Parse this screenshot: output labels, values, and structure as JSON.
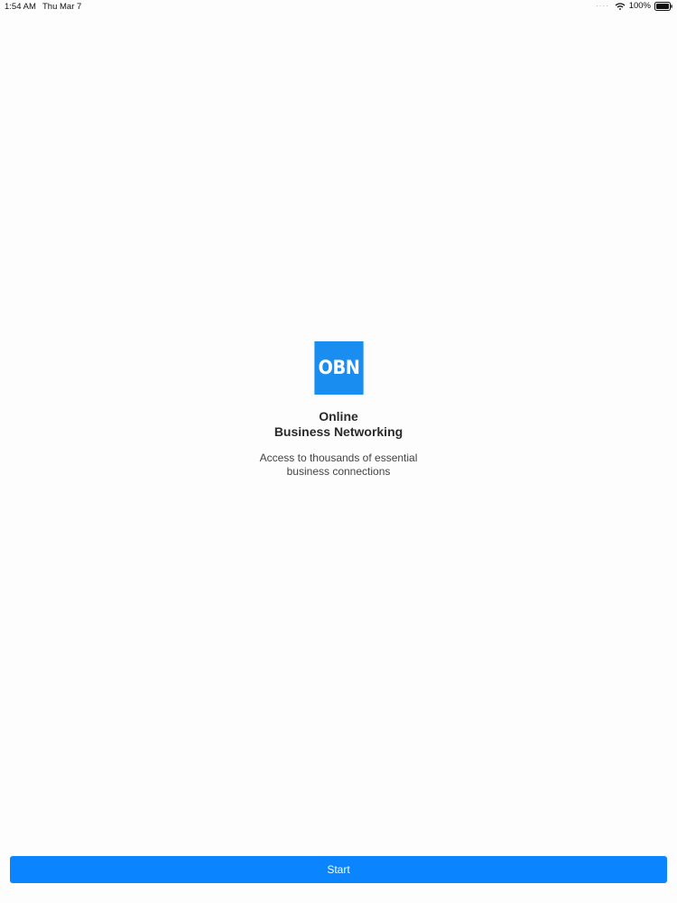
{
  "status_bar": {
    "time": "1:54 AM",
    "date": "Thu Mar 7",
    "battery_percent": "100%",
    "battery_level": 1.0,
    "icons": [
      "wifi-icon",
      "battery-icon"
    ]
  },
  "splash": {
    "logo_text": "OBN",
    "title_line1": "Online",
    "title_line2": "Business Networking",
    "tagline_line1": "Access to thousands of essential",
    "tagline_line2": "business connections"
  },
  "actions": {
    "start_label": "Start"
  },
  "colors": {
    "brand": "#1a8ef0",
    "button": "#0a84ff",
    "background": "#fdfdfd"
  }
}
